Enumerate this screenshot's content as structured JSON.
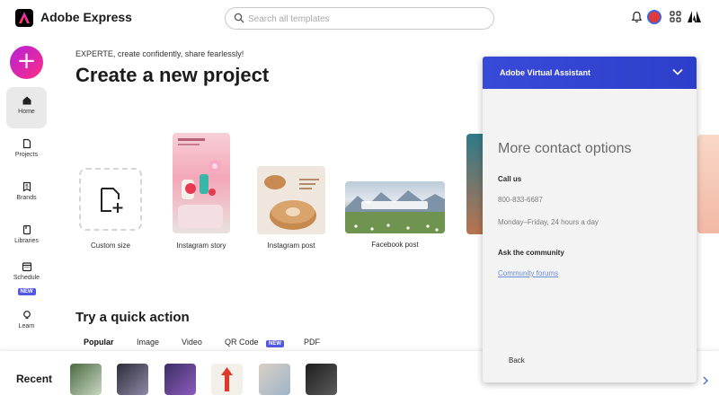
{
  "app": {
    "title": "Adobe Express"
  },
  "search": {
    "placeholder": "Search all templates"
  },
  "nav": {
    "items": [
      {
        "label": "Home"
      },
      {
        "label": "Projects"
      },
      {
        "label": "Brands"
      },
      {
        "label": "Libraries"
      },
      {
        "label": "Schedule",
        "badge": "NEW"
      },
      {
        "label": "Learn"
      }
    ]
  },
  "main": {
    "greeting": "EXPERTE, create confidently, share fearlessly!",
    "title": "Create a new project",
    "cards": [
      {
        "label": "Custom size"
      },
      {
        "label": "Instagram story"
      },
      {
        "label": "Instagram post"
      },
      {
        "label": "Facebook post"
      }
    ],
    "quick_action": {
      "title": "Try a quick action",
      "tabs": [
        {
          "label": "Popular"
        },
        {
          "label": "Image"
        },
        {
          "label": "Video"
        },
        {
          "label": "QR Code",
          "badge": "NEW"
        },
        {
          "label": "PDF"
        }
      ]
    }
  },
  "recent": {
    "title": "Recent"
  },
  "assistant": {
    "title": "Adobe Virtual Assistant",
    "heading": "More contact options",
    "call_label": "Call us",
    "phone": "800-833-6687",
    "hours": "Monday–Friday, 24 hours a day",
    "community_label": "Ask the community",
    "community_link": "Community forums",
    "back": "Back"
  },
  "colors": {
    "accent": "#5258e4",
    "assistant_header": "#3a4ad8",
    "fab_start": "#b321d9",
    "fab_end": "#ff2d84"
  }
}
